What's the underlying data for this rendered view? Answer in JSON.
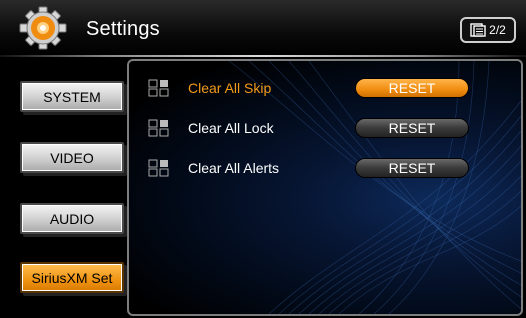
{
  "header": {
    "title": "Settings",
    "page_indicator": "2/2",
    "icon": "gear-icon",
    "page_icon": "pages-icon"
  },
  "sidebar": {
    "items": [
      {
        "label": "SYSTEM",
        "active": false
      },
      {
        "label": "VIDEO",
        "active": false
      },
      {
        "label": "AUDIO",
        "active": false
      },
      {
        "label": "SiriusXM Set",
        "active": true
      }
    ]
  },
  "main": {
    "rows": [
      {
        "label": "Clear All Skip",
        "button": "RESET",
        "active": true,
        "icon": "channel-grid-icon"
      },
      {
        "label": "Clear All Lock",
        "button": "RESET",
        "active": false,
        "icon": "channel-grid-icon"
      },
      {
        "label": "Clear All Alerts",
        "button": "RESET",
        "active": false,
        "icon": "channel-grid-icon"
      }
    ]
  },
  "colors": {
    "accent": "#f39a1c",
    "panel_bg": "#071634",
    "button_dark": "#3a3a3a"
  }
}
